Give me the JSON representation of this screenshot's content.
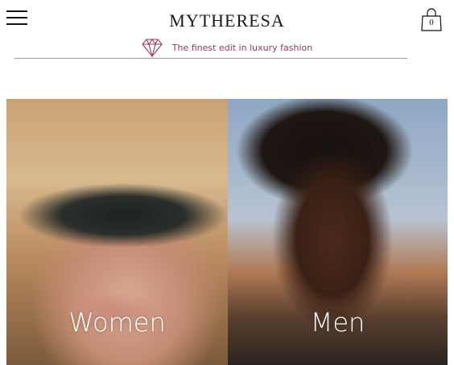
{
  "header": {
    "logo": "MYTHERESA",
    "bag_count": "0",
    "tagline": "The finest edit in luxury fashion"
  },
  "categories": [
    {
      "label": "Women"
    },
    {
      "label": "Men"
    }
  ],
  "colors": {
    "accent": "#9b3a5a"
  }
}
